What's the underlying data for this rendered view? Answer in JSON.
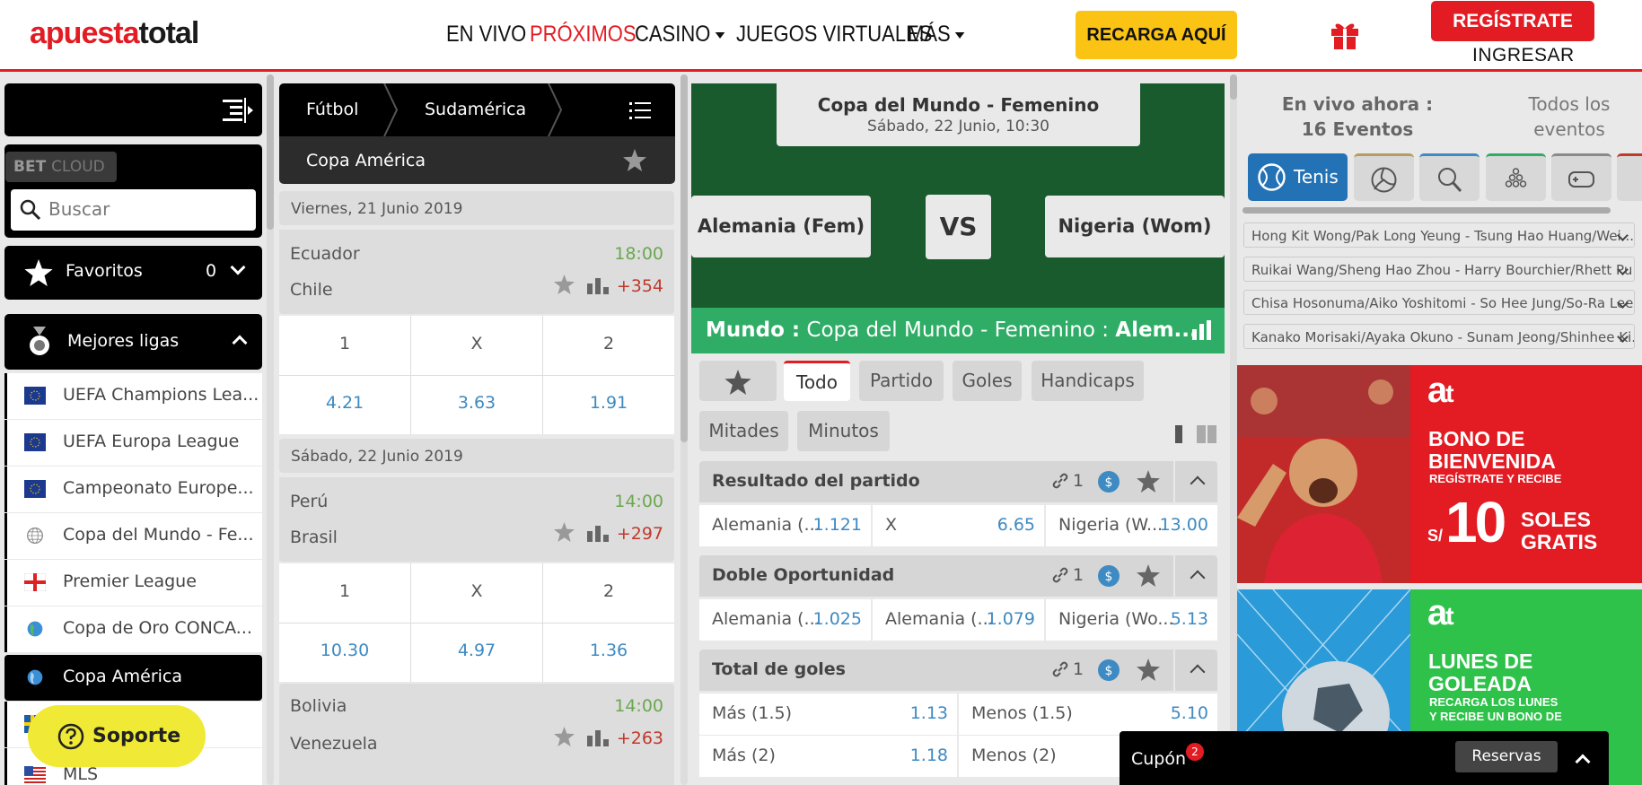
{
  "header": {
    "logo_a": "apuesta",
    "logo_b": "total",
    "nav": [
      "EN VIVO",
      "PRÓXIMOS",
      "CASINO",
      "JUEGOS VIRTUALES",
      "MÁS"
    ],
    "recarga": "RECARGA AQUÍ",
    "registrate": "REGÍSTRATE",
    "ingresar": "INGRESAR"
  },
  "sidebar": {
    "betcloud_a": "BET",
    "betcloud_b": "CLOUD",
    "search_placeholder": "Buscar",
    "favoritos": "Favoritos",
    "favoritos_count": "0",
    "mejores_ligas": "Mejores ligas",
    "leagues": [
      "UEFA Champions Lea...",
      "UEFA Europa League",
      "Campeonato Europe...",
      "Copa del Mundo - Fe...",
      "Premier League",
      "Copa de Oro CONCA...",
      "Copa América",
      "",
      "MLS"
    ]
  },
  "events": {
    "breadcrumb": [
      "Fútbol",
      "Sudamérica"
    ],
    "competition": "Copa América",
    "dates": [
      "Viernes, 21 Junio 2019",
      "Sábado, 22 Junio 2019"
    ],
    "matches": [
      {
        "home": "Ecuador",
        "away": "Chile",
        "time": "18:00",
        "more": "+354",
        "labels": [
          "1",
          "X",
          "2"
        ],
        "odds": [
          "4.21",
          "3.63",
          "1.91"
        ]
      },
      {
        "home": "Perú",
        "away": "Brasil",
        "time": "14:00",
        "more": "+297",
        "labels": [
          "1",
          "X",
          "2"
        ],
        "odds": [
          "10.30",
          "4.97",
          "1.36"
        ]
      },
      {
        "home": "Bolivia",
        "away": "Venezuela",
        "time": "14:00",
        "more": "+263"
      }
    ]
  },
  "detail": {
    "competition": "Copa del Mundo - Femenino",
    "datetime": "Sábado, 22 Junio, 10:30",
    "home": "Alemania (Fem)",
    "vs": "VS",
    "away": "Nigeria (Wom)",
    "breadcrumb_a": "Mundo :",
    "breadcrumb_b": "Copa del Mundo - Femenino :",
    "breadcrumb_c": "Alem...",
    "tabs": [
      "Todo",
      "Partido",
      "Goles",
      "Handicaps",
      "Mitades",
      "Minutos"
    ],
    "markets": [
      {
        "title": "Resultado del partido",
        "links": "1",
        "outcomes": [
          {
            "name": "Alemania (...",
            "odd": "1.121"
          },
          {
            "name": "X",
            "odd": "6.65"
          },
          {
            "name": "Nigeria (W...",
            "odd": "13.00"
          }
        ]
      },
      {
        "title": "Doble Oportunidad",
        "links": "1",
        "outcomes": [
          {
            "name": "Alemania (...",
            "odd": "1.025"
          },
          {
            "name": "Alemania (...",
            "odd": "1.079"
          },
          {
            "name": "Nigeria (Wo...",
            "odd": "5.13"
          }
        ]
      },
      {
        "title": "Total de goles",
        "links": "1",
        "rows": [
          [
            {
              "name": "Más (1.5)",
              "odd": "1.13"
            },
            {
              "name": "Menos (1.5)",
              "odd": "5.10"
            }
          ],
          [
            {
              "name": "Más (2)",
              "odd": "1.18"
            },
            {
              "name": "Menos (2)",
              "odd": ""
            }
          ]
        ]
      }
    ]
  },
  "live": {
    "title": "En vivo ahora : 16 Eventos",
    "all": "Todos los eventos",
    "active_sport": "Tenis",
    "events": [
      "Hong Kit Wong/Pak Long Yeung - Tsung Hao Huang/Wei ...",
      "Ruikai Wang/Sheng Hao Zhou - Harry Bourchier/Rhett Pu...",
      "Chisa Hosonuma/Aiko Yoshitomi - So Hee Jung/So-Ra Lee...",
      "Kanako Morisaki/Ayaka Okuno - Sunam Jeong/Shinhee Ki..."
    ]
  },
  "banners": {
    "b1_line1": "BONO DE",
    "b1_line2": "BIENVENIDA",
    "b1_line3": "REGÍSTRATE Y RECIBE",
    "b1_currency": "S/",
    "b1_amount": "10",
    "b1_line4": "SOLES",
    "b1_line5": "GRATIS",
    "b2_line1": "LUNES DE",
    "b2_line2": "GOLEADA",
    "b2_line3": "RECARGA LOS LUNES",
    "b2_line4": "Y RECIBE UN BONO DE"
  },
  "footer": {
    "soporte": "Soporte",
    "cupon": "Cupón",
    "cupon_count": "2",
    "reservas": "Reservas"
  },
  "colors": {
    "brand_red": "#e31b23",
    "odds_blue": "#3e8ac2",
    "green": "#2fac66",
    "dark_green": "#1a5b2e",
    "yellow": "#fbc313"
  }
}
